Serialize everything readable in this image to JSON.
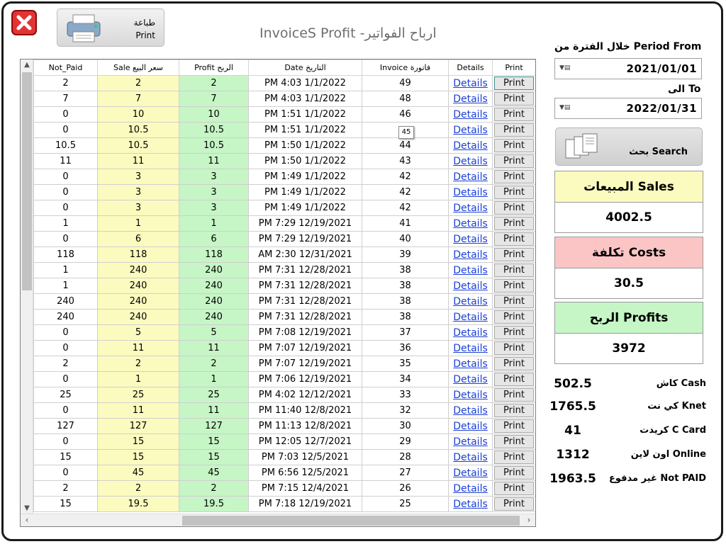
{
  "window": {
    "title": "InvoiceS Profit -ارباح الفواتير"
  },
  "toolbar": {
    "print_ar": "طباعة",
    "print_en": "Print"
  },
  "filters": {
    "from_label": "خلال الفترة من Period From",
    "from_value": "2021/01/01",
    "to_label": "الى To",
    "to_value": "2022/01/31",
    "search_label": "بحث Search"
  },
  "summary": {
    "sales_label": "المبيعات Sales",
    "sales_value": "4002.5",
    "costs_label": "تكلفة Costs",
    "costs_value": "30.5",
    "profits_label": "الربح Profits",
    "profits_value": "3972"
  },
  "payments": [
    {
      "label": "كاش Cash",
      "value": "502.5"
    },
    {
      "label": "كي نت Knet",
      "value": "1765.5"
    },
    {
      "label": "كريدت C Card",
      "value": "41"
    },
    {
      "label": "اون لاين Online",
      "value": "1312"
    },
    {
      "label": "غير مدفوع Not PAID",
      "value": "1963.5"
    }
  ],
  "tooltip": "45",
  "table": {
    "headers": {
      "not_paid": "Not_Paid",
      "sale": "Sale سعر البيع",
      "profit": "Profit الربح",
      "date": "Date التاريخ",
      "invoice": "Invoice فاتورة",
      "details": "Details",
      "print": "Print"
    },
    "details_text": "Details",
    "print_text": "Print",
    "rows": [
      {
        "not_paid": "2",
        "sale": "2",
        "profit": "2",
        "date": "PM 4:03 1/1/2022",
        "invoice": "49"
      },
      {
        "not_paid": "7",
        "sale": "7",
        "profit": "7",
        "date": "PM 4:03 1/1/2022",
        "invoice": "48"
      },
      {
        "not_paid": "0",
        "sale": "10",
        "profit": "10",
        "date": "PM 1:51 1/1/2022",
        "invoice": "46"
      },
      {
        "not_paid": "0",
        "sale": "10.5",
        "profit": "10.5",
        "date": "PM 1:51 1/1/2022",
        "invoice": ""
      },
      {
        "not_paid": "10.5",
        "sale": "10.5",
        "profit": "10.5",
        "date": "PM 1:50 1/1/2022",
        "invoice": "44"
      },
      {
        "not_paid": "11",
        "sale": "11",
        "profit": "11",
        "date": "PM 1:50 1/1/2022",
        "invoice": "43"
      },
      {
        "not_paid": "0",
        "sale": "3",
        "profit": "3",
        "date": "PM 1:49 1/1/2022",
        "invoice": "42"
      },
      {
        "not_paid": "0",
        "sale": "3",
        "profit": "3",
        "date": "PM 1:49 1/1/2022",
        "invoice": "42"
      },
      {
        "not_paid": "0",
        "sale": "3",
        "profit": "3",
        "date": "PM 1:49 1/1/2022",
        "invoice": "42"
      },
      {
        "not_paid": "1",
        "sale": "1",
        "profit": "1",
        "date": "PM 7:29 12/19/2021",
        "invoice": "41"
      },
      {
        "not_paid": "0",
        "sale": "6",
        "profit": "6",
        "date": "PM 7:29 12/19/2021",
        "invoice": "40"
      },
      {
        "not_paid": "118",
        "sale": "118",
        "profit": "118",
        "date": "AM 2:30 12/31/2021",
        "invoice": "39"
      },
      {
        "not_paid": "1",
        "sale": "240",
        "profit": "240",
        "date": "PM 7:31 12/28/2021",
        "invoice": "38"
      },
      {
        "not_paid": "1",
        "sale": "240",
        "profit": "240",
        "date": "PM 7:31 12/28/2021",
        "invoice": "38"
      },
      {
        "not_paid": "240",
        "sale": "240",
        "profit": "240",
        "date": "PM 7:31 12/28/2021",
        "invoice": "38"
      },
      {
        "not_paid": "240",
        "sale": "240",
        "profit": "240",
        "date": "PM 7:31 12/28/2021",
        "invoice": "38"
      },
      {
        "not_paid": "0",
        "sale": "5",
        "profit": "5",
        "date": "PM 7:08 12/19/2021",
        "invoice": "37"
      },
      {
        "not_paid": "0",
        "sale": "11",
        "profit": "11",
        "date": "PM 7:07 12/19/2021",
        "invoice": "36"
      },
      {
        "not_paid": "2",
        "sale": "2",
        "profit": "2",
        "date": "PM 7:07 12/19/2021",
        "invoice": "35"
      },
      {
        "not_paid": "0",
        "sale": "1",
        "profit": "1",
        "date": "PM 7:06 12/19/2021",
        "invoice": "34"
      },
      {
        "not_paid": "25",
        "sale": "25",
        "profit": "25",
        "date": "PM 4:02 12/12/2021",
        "invoice": "33"
      },
      {
        "not_paid": "0",
        "sale": "11",
        "profit": "11",
        "date": "PM 11:40 12/8/2021",
        "invoice": "32"
      },
      {
        "not_paid": "127",
        "sale": "127",
        "profit": "127",
        "date": "PM 11:13 12/8/2021",
        "invoice": "30"
      },
      {
        "not_paid": "0",
        "sale": "15",
        "profit": "15",
        "date": "PM 12:05 12/7/2021",
        "invoice": "29"
      },
      {
        "not_paid": "15",
        "sale": "15",
        "profit": "15",
        "date": "PM 7:03 12/5/2021",
        "invoice": "28"
      },
      {
        "not_paid": "0",
        "sale": "45",
        "profit": "45",
        "date": "PM 6:56 12/5/2021",
        "invoice": "27"
      },
      {
        "not_paid": "2",
        "sale": "2",
        "profit": "2",
        "date": "PM 7:15 12/4/2021",
        "invoice": "26"
      },
      {
        "not_paid": "15",
        "sale": "19.5",
        "profit": "19.5",
        "date": "PM 7:18 12/19/2021",
        "invoice": "25"
      }
    ]
  }
}
